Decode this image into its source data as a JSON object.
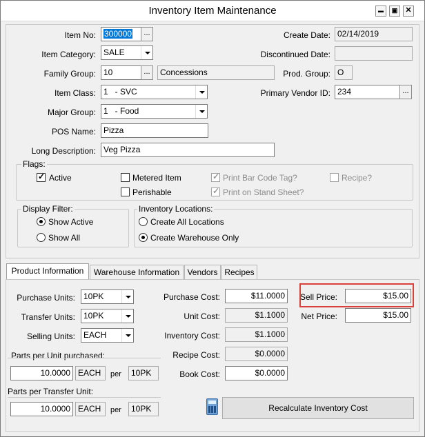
{
  "window": {
    "title": "Inventory Item Maintenance",
    "minimize": "▬",
    "maximize": "▣",
    "close": "✕"
  },
  "header": {
    "item_no_label": "Item No:",
    "item_no_value": "300000",
    "item_category_label": "Item Category:",
    "item_category_value": "SALE",
    "family_group_label": "Family Group:",
    "family_group_value": "10",
    "family_group_desc": "Concessions",
    "item_class_label": "Item Class:",
    "item_class_value": "1   - SVC",
    "major_group_label": "Major Group:",
    "major_group_value": "1   - Food",
    "pos_name_label": "POS Name:",
    "pos_name_value": "Pizza",
    "long_desc_label": "Long Description:",
    "long_desc_value": "Veg Pizza",
    "create_date_label": "Create Date:",
    "create_date_value": "02/14/2019",
    "discontinued_label": "Discontinued Date:",
    "discontinued_value": "",
    "prod_group_label": "Prod. Group:",
    "prod_group_value": "O",
    "vendor_label": "Primary Vendor ID:",
    "vendor_value": "234",
    "ellipsis": "..."
  },
  "flags": {
    "title": "Flags:",
    "active": "Active",
    "metered": "Metered Item",
    "perishable": "Perishable",
    "print_barcode": "Print Bar Code Tag?",
    "print_stand": "Print on Stand Sheet?",
    "recipe": "Recipe?",
    "check": "✓"
  },
  "display_filter": {
    "title": "Display Filter:",
    "show_active": "Show Active",
    "show_all": "Show All"
  },
  "inventory_locations": {
    "title": "Inventory Locations:",
    "create_all": "Create All Locations",
    "create_warehouse": "Create Warehouse Only"
  },
  "tabs": [
    {
      "label": "Product Information"
    },
    {
      "label": "Warehouse Information"
    },
    {
      "label": "Vendors"
    },
    {
      "label": "Recipes"
    }
  ],
  "product": {
    "purchase_units_label": "Purchase Units:",
    "purchase_units_value": "10PK",
    "transfer_units_label": "Transfer Units:",
    "transfer_units_value": "10PK",
    "selling_units_label": "Selling Units:",
    "selling_units_value": "EACH",
    "parts_purchased_label": "Parts per Unit purchased:",
    "parts_purchased_value": "10.0000",
    "parts_purchased_unit": "EACH",
    "per": "per",
    "parts_purchased_per": "10PK",
    "parts_transfer_label": "Parts per Transfer Unit:",
    "parts_transfer_value": "10.0000",
    "parts_transfer_unit": "EACH",
    "parts_transfer_per": "10PK",
    "purchase_cost_label": "Purchase Cost:",
    "purchase_cost_value": "$11.0000",
    "unit_cost_label": "Unit Cost:",
    "unit_cost_value": "$1.1000",
    "inventory_cost_label": "Inventory Cost:",
    "inventory_cost_value": "$1.1000",
    "recipe_cost_label": "Recipe Cost:",
    "recipe_cost_value": "$0.0000",
    "book_cost_label": "Book Cost:",
    "book_cost_value": "$0.0000",
    "sell_price_label": "Sell Price:",
    "sell_price_value": "$15.00",
    "net_price_label": "Net Price:",
    "net_price_value": "$15.00",
    "recalc_button": "Recalculate Inventory Cost"
  },
  "colors": {
    "highlight_box": "#d9403a",
    "selection": "#0078d7"
  }
}
